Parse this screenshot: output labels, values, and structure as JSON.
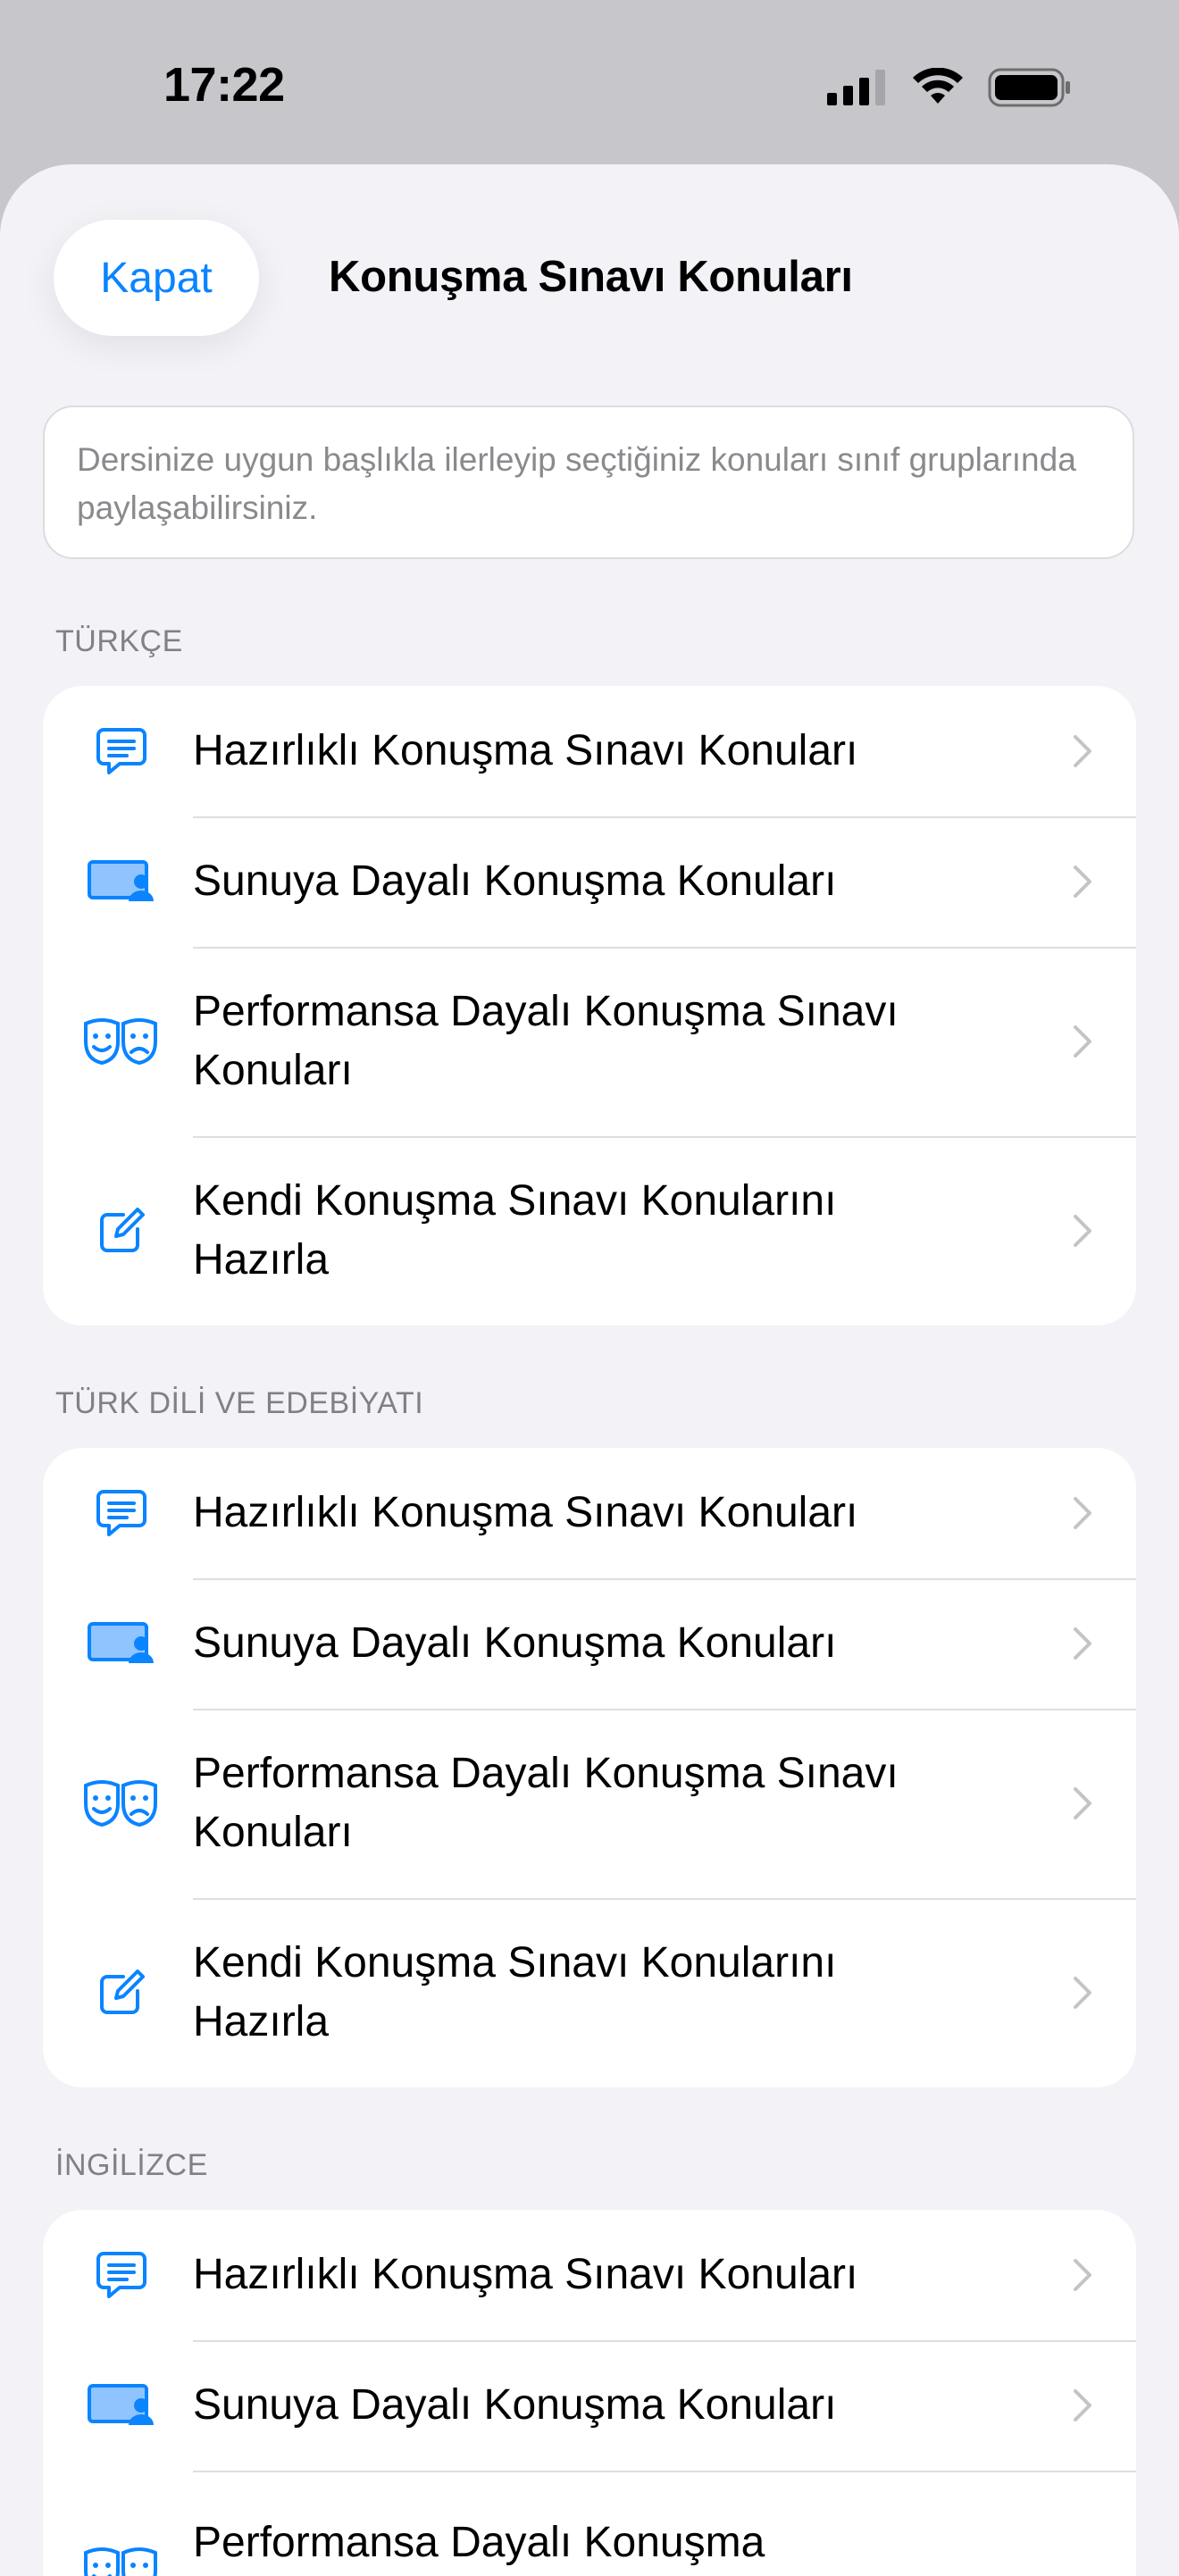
{
  "status": {
    "time": "17:22"
  },
  "header": {
    "close_label": "Kapat",
    "title": "Konuşma Sınavı Konuları"
  },
  "info": {
    "text": "Dersinize uygun başlıkla ilerleyip seçtiğiniz konuları sınıf gruplarında paylaşabilirsiniz."
  },
  "sections": [
    {
      "title": "TÜRKÇE",
      "items": [
        {
          "label": "Hazırlıklı Konuşma Sınavı Konuları",
          "icon": "message-icon"
        },
        {
          "label": "Sunuya Dayalı Konuşma Konuları",
          "icon": "presentation-icon"
        },
        {
          "label": "Performansa Dayalı Konuşma Sınavı Konuları",
          "icon": "theater-masks-icon"
        },
        {
          "label": "Kendi Konuşma Sınavı Konularını Hazırla",
          "icon": "edit-icon"
        }
      ]
    },
    {
      "title": "TÜRK DİLİ VE EDEBİYATI",
      "items": [
        {
          "label": "Hazırlıklı Konuşma Sınavı Konuları",
          "icon": "message-icon"
        },
        {
          "label": "Sunuya Dayalı Konuşma Konuları",
          "icon": "presentation-icon"
        },
        {
          "label": "Performansa Dayalı Konuşma Sınavı Konuları",
          "icon": "theater-masks-icon"
        },
        {
          "label": "Kendi Konuşma Sınavı Konularını Hazırla",
          "icon": "edit-icon"
        }
      ]
    },
    {
      "title": "İNGİLİZCE",
      "items": [
        {
          "label": "Hazırlıklı Konuşma Sınavı Konuları",
          "icon": "message-icon"
        },
        {
          "label": "Sunuya Dayalı Konuşma Konuları",
          "icon": "presentation-icon"
        },
        {
          "label": "Performansa Dayalı Konuşma",
          "icon": "theater-masks-icon"
        }
      ]
    }
  ],
  "colors": {
    "accent": "#0a84ff",
    "background": "#f2f2f7"
  }
}
